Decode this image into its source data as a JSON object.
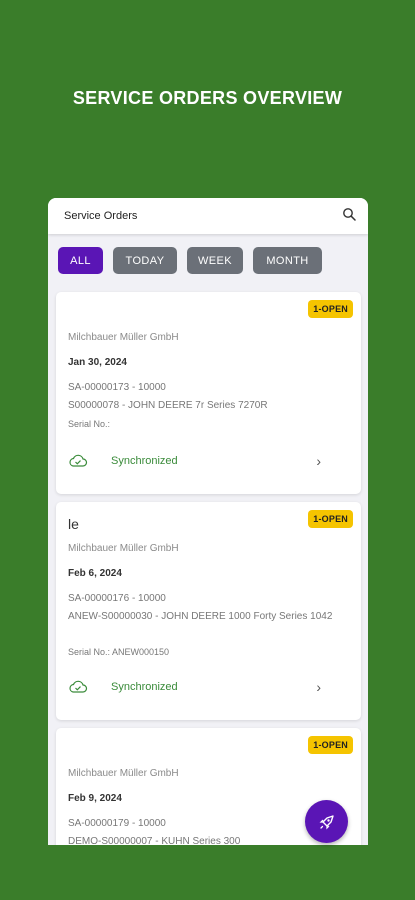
{
  "headline": "SERVICE ORDERS OVERVIEW",
  "appbar": {
    "title": "Service Orders",
    "search_icon": "search-icon"
  },
  "filters": [
    {
      "label": "ALL",
      "active": true
    },
    {
      "label": "TODAY",
      "active": false
    },
    {
      "label": "WEEK",
      "active": false
    },
    {
      "label": "MONTH",
      "active": false
    }
  ],
  "orders": [
    {
      "badge": "1-OPEN",
      "company": "Milchbauer Müller GmbH",
      "date": "Jan 30, 2024",
      "ref": "SA-00000173 - 10000",
      "machine": "S00000078 - JOHN DEERE 7r Series 7270R",
      "serial": "Serial No.:",
      "status": "Synchronized"
    },
    {
      "badge": "1-OPEN",
      "short_title": "le",
      "company": "Milchbauer Müller GmbH",
      "date": "Feb 6, 2024",
      "ref": "SA-00000176 - 10000",
      "machine": "ANEW-S00000030 - JOHN DEERE 1000 Forty Series 1042",
      "serial": "Serial No.: ANEW000150",
      "status": "Synchronized"
    },
    {
      "badge": "1-OPEN",
      "company": "Milchbauer Müller GmbH",
      "date": "Feb 9, 2024",
      "ref": "SA-00000179 - 10000",
      "machine": "DEMO-S00000007 - KUHN Series 300"
    }
  ],
  "colors": {
    "background": "#3a7d2a",
    "accent": "#5a15b5",
    "badge": "#f5c400",
    "sync": "#3a8b3a"
  },
  "fab_icon": "rocket-icon"
}
